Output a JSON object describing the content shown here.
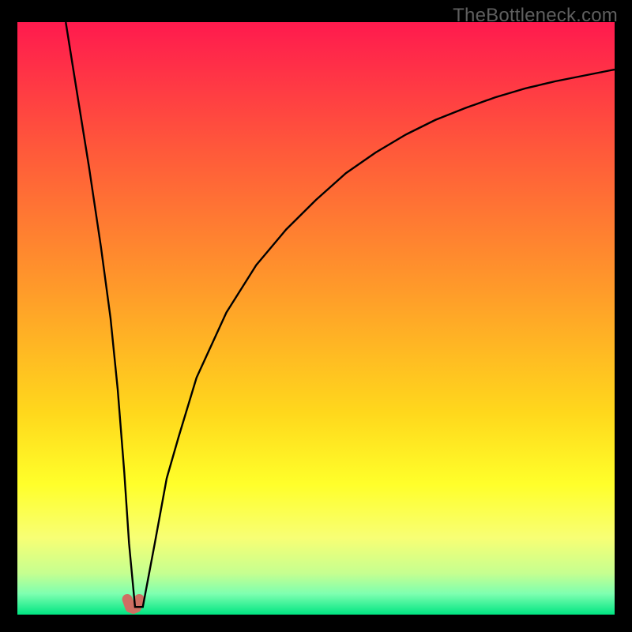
{
  "watermark": "TheBottleneck.com",
  "chart_data": {
    "type": "line",
    "title": "",
    "xlabel": "",
    "ylabel": "",
    "xlim": [
      0,
      100
    ],
    "ylim": [
      0,
      100
    ],
    "grid": false,
    "series": [
      {
        "name": "curve",
        "x": [
          8.1,
          10,
          12,
          14,
          15.6,
          16.8,
          17.9,
          18.7,
          19.7,
          21,
          23,
          25,
          27,
          30,
          35,
          40,
          45,
          50,
          55,
          60,
          65,
          70,
          75,
          80,
          85,
          90,
          95,
          100
        ],
        "y": [
          100,
          88,
          75.5,
          62,
          50,
          38,
          24,
          12,
          1.3,
          1.3,
          12,
          23,
          30,
          40,
          51,
          59,
          65,
          70,
          74.5,
          78,
          81,
          83.5,
          85.5,
          87.3,
          88.8,
          90,
          91,
          92
        ]
      },
      {
        "name": "minimum-marker",
        "x": [
          18.4,
          18.9,
          19.4,
          19.9,
          20.4
        ],
        "y": [
          2.6,
          1.2,
          1.0,
          1.2,
          2.6
        ]
      }
    ],
    "colors": {
      "curve": "#000000",
      "marker": "#cf6f63",
      "gradient_stops": [
        {
          "offset": 0.0,
          "color": "#ff1a4e"
        },
        {
          "offset": 0.22,
          "color": "#ff5a3a"
        },
        {
          "offset": 0.45,
          "color": "#ff9a2a"
        },
        {
          "offset": 0.66,
          "color": "#ffd81c"
        },
        {
          "offset": 0.78,
          "color": "#ffff2a"
        },
        {
          "offset": 0.87,
          "color": "#f8ff74"
        },
        {
          "offset": 0.93,
          "color": "#c6ff90"
        },
        {
          "offset": 0.965,
          "color": "#7dffb0"
        },
        {
          "offset": 1.0,
          "color": "#00e582"
        }
      ]
    }
  }
}
